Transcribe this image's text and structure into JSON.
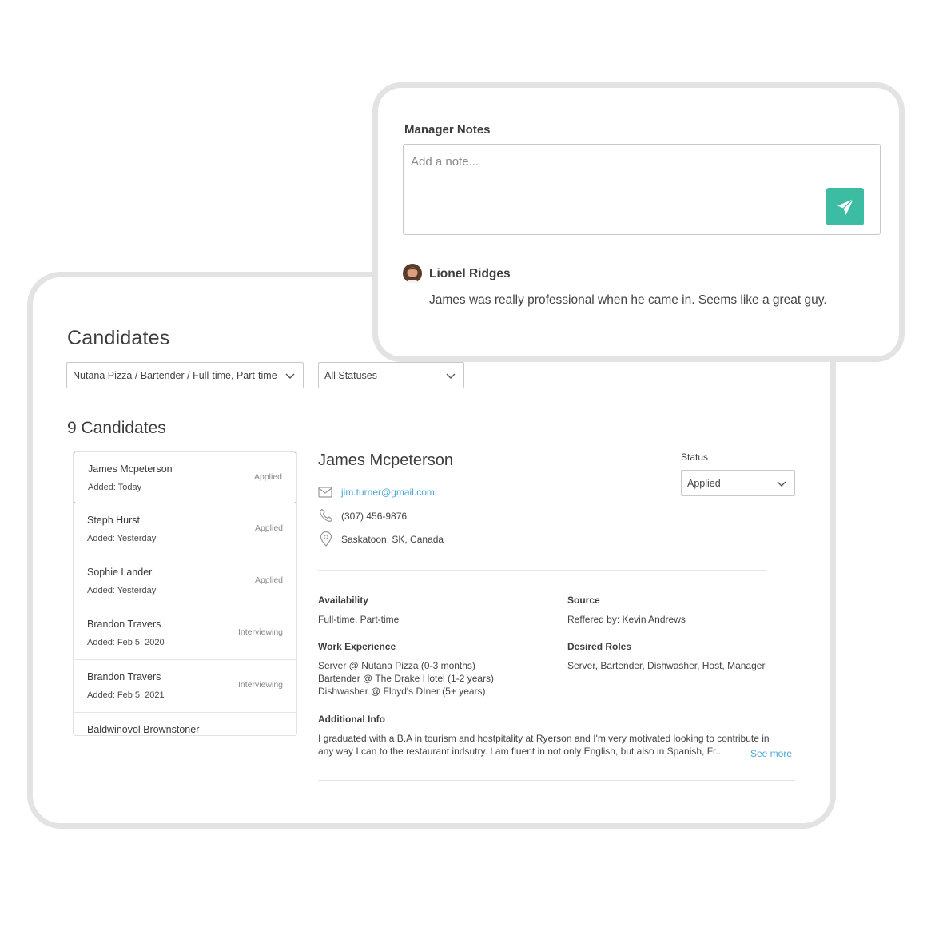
{
  "candidates_panel": {
    "title": "Candidates",
    "job_filter": "Nutana Pizza / Bartender / Full-time, Part-time",
    "status_filter": "All Statuses",
    "count_heading": "9 Candidates",
    "list": [
      {
        "name": "James Mcpeterson",
        "added": "Added: Today",
        "status": "Applied"
      },
      {
        "name": "Steph Hurst",
        "added": "Added: Yesterday",
        "status": "Applied"
      },
      {
        "name": "Sophie Lander",
        "added": "Added: Yesterday",
        "status": "Applied"
      },
      {
        "name": "Brandon Travers",
        "added": "Added: Feb 5, 2020",
        "status": "Interviewing"
      },
      {
        "name": "Brandon Travers",
        "added": "Added: Feb 5, 2021",
        "status": "Interviewing"
      },
      {
        "name": "Baldwinovol Brownstoner",
        "added": "",
        "status": ""
      }
    ]
  },
  "detail": {
    "name": "James Mcpeterson",
    "email": "jim.turner@gmail.com",
    "phone": "(307) 456-9876",
    "location": "Saskatoon, SK, Canada",
    "status_label": "Status",
    "status_value": "Applied",
    "availability_label": "Availability",
    "availability": "Full-time, Part-time",
    "source_label": "Source",
    "source": "Reffered by: Kevin Andrews",
    "work_label": "Work Experience",
    "work": [
      "Server @ Nutana Pizza (0-3 months)",
      "Bartender @ The Drake Hotel (1-2 years)",
      "Dishwasher @ Floyd's DIner (5+ years)"
    ],
    "roles_label": "Desired Roles",
    "roles": "Server, Bartender, Dishwasher, Host, Manager",
    "info_label": "Additional Info",
    "info_line1": "I graduated with a B.A in tourism and hostpitality at Ryerson and I'm very motivated looking to contribute in",
    "info_line2": "any way I can to the restaurant indsutry. I am fluent in not only English, but also in Spanish, Fr...",
    "see_more": "See more"
  },
  "notes": {
    "title": "Manager Notes",
    "placeholder": "Add a note...",
    "author": "Lionel Ridges",
    "text": "James was really professional when he came in. Seems like a great guy."
  },
  "colors": {
    "accent": "#3dbca4",
    "link": "#4aa7d8",
    "selected_border": "#6b8fe0",
    "card_border": "#e3e3e3"
  },
  "icons": {
    "send": "paper-plane-icon",
    "email": "envelope-icon",
    "phone": "phone-icon",
    "location": "map-pin-icon",
    "dropdown": "chevron-down-icon"
  }
}
